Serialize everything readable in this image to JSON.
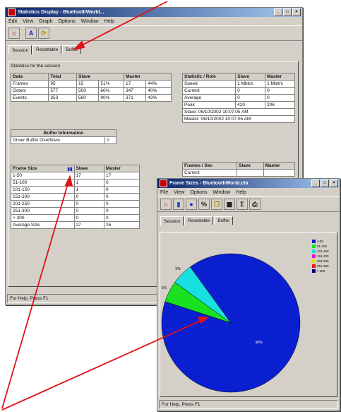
{
  "main_window": {
    "title": "Statistics Display - BluetoothWorld...",
    "menu": [
      "Edit",
      "View",
      "Graph",
      "Options",
      "Window",
      "Help"
    ],
    "tabs": [
      "Session",
      "Resettable",
      "Buffer"
    ],
    "caption": "Statistics for the session",
    "data_table": {
      "headers": [
        "Data",
        "Total",
        "Slave",
        "",
        "Master",
        ""
      ],
      "rows": [
        [
          "Frames",
          "95",
          "15",
          "51%",
          "17",
          "44%"
        ],
        [
          "Octets",
          "577",
          "500",
          "60%",
          "347",
          "40%"
        ],
        [
          "Events",
          "353",
          "560",
          "90%",
          "371",
          "43%"
        ]
      ]
    },
    "stats_table": {
      "headers": [
        "Statistic / Role",
        "Slave",
        "Master"
      ],
      "rows": [
        [
          "Speed",
          "1 Mbit/s",
          "1 Mbit/s"
        ],
        [
          "Current",
          "0",
          "0"
        ],
        [
          "Average",
          "0",
          "0"
        ],
        [
          "Peak",
          "420",
          "206"
        ]
      ],
      "slave_line": "Slave: 06/10/2002 10:07:05 AM",
      "master_line": "Master: 06/10/2002 10:07:05 AM"
    },
    "buffer": {
      "title": "Buffer Information",
      "label": "Driver Buffer Overflows",
      "value": "0"
    },
    "frame_size_table": {
      "headers": [
        "Frame Size",
        "Slave",
        "Master"
      ],
      "rows": [
        [
          "1-50",
          "17",
          "17"
        ],
        [
          "51-100",
          "1",
          "0"
        ],
        [
          "101-150",
          "1",
          "0"
        ],
        [
          "151-200",
          "0",
          "0"
        ],
        [
          "201-250",
          "0",
          "0"
        ],
        [
          "251-300",
          "0",
          "0"
        ],
        [
          "> 300",
          "0",
          "0"
        ],
        [
          "Average Size",
          "27",
          "26"
        ]
      ]
    },
    "frames_sec_table": {
      "headers": [
        "Frames / Sec",
        "Slave",
        "Master"
      ],
      "rows": [
        [
          "Current",
          "",
          ""
        ]
      ]
    },
    "status": "For Help, Press F1"
  },
  "chart_window": {
    "title": "Frame Sizes - BluetoothWorld.cfa",
    "menu": [
      "File",
      "View",
      "Options",
      "Window",
      "Help"
    ],
    "tabs": [
      "Session",
      "Resettable",
      "Buffer"
    ],
    "toolbar_icons": [
      "home-icon",
      "bar-chart-icon",
      "pie-chart-icon",
      "percent-icon",
      "copy-icon",
      "table-icon",
      "sigma-icon",
      "print-icon"
    ],
    "status": "For Help, Press F1"
  },
  "chart_data": {
    "type": "pie",
    "title": "",
    "categories": [
      "1-50",
      "51-100",
      "101-150",
      "151-200",
      "201-250",
      "251-300",
      "> 300"
    ],
    "values": [
      90,
      5,
      5,
      0,
      0,
      0,
      0
    ],
    "colors": [
      "#0a1fd0",
      "#19e021",
      "#19e0e0",
      "#e019e0",
      "#e0e019",
      "#e01919",
      "#000080"
    ],
    "slice_labels": [
      "90%",
      "5%",
      "5%"
    ],
    "legend_placement": "right"
  },
  "annotation_color": "#e0101a"
}
